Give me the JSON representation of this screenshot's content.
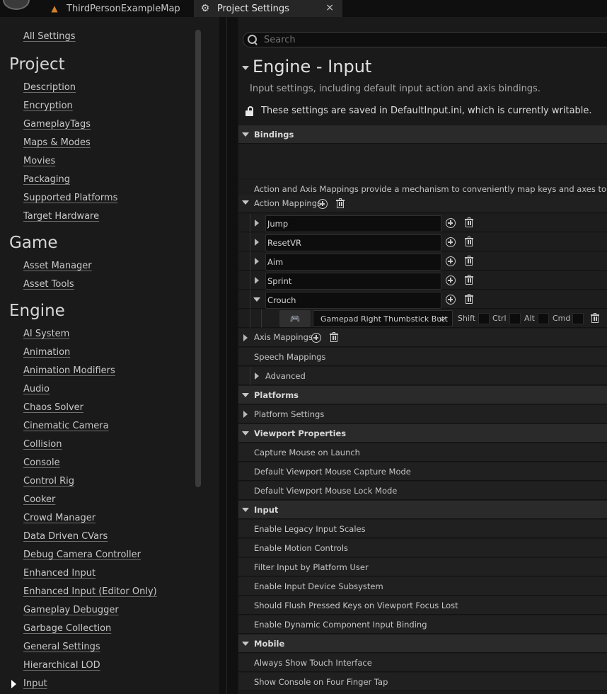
{
  "tabs": {
    "map": "ThirdPersonExampleMap",
    "settings": "Project Settings",
    "close": "×"
  },
  "sidebar": {
    "all_settings": "All Settings",
    "project_heading": "Project",
    "project_items": [
      "Description",
      "Encryption",
      "GameplayTags",
      "Maps & Modes",
      "Movies",
      "Packaging",
      "Supported Platforms",
      "Target Hardware"
    ],
    "game_heading": "Game",
    "game_items": [
      "Asset Manager",
      "Asset Tools"
    ],
    "engine_heading": "Engine",
    "engine_items": [
      "AI System",
      "Animation",
      "Animation Modifiers",
      "Audio",
      "Chaos Solver",
      "Cinematic Camera",
      "Collision",
      "Console",
      "Control Rig",
      "Cooker",
      "Crowd Manager",
      "Data Driven CVars",
      "Debug Camera Controller",
      "Enhanced Input",
      "Enhanced Input (Editor Only)",
      "Gameplay Debugger",
      "Garbage Collection",
      "General Settings",
      "Hierarchical LOD",
      "Input"
    ]
  },
  "search": {
    "placeholder": "Search"
  },
  "page": {
    "title": "Engine - Input",
    "subtitle": "Input settings, including default input action and axis bindings.",
    "writable_note": "These settings are saved in DefaultInput.ini, which is currently writable."
  },
  "bindings": {
    "header": "Bindings",
    "description": "Action and Axis Mappings provide a mechanism to conveniently map keys and axes to input behavi",
    "action_mappings_label": "Action Mappings",
    "actions": [
      "Jump",
      "ResetVR",
      "Aim",
      "Sprint",
      "Crouch"
    ],
    "crouch_key": "Gamepad Right Thumbstick Butt",
    "modifiers": [
      "Shift",
      "Ctrl",
      "Alt",
      "Cmd"
    ],
    "axis_mappings_label": "Axis Mappings",
    "speech_mappings_label": "Speech Mappings",
    "advanced_label": "Advanced"
  },
  "platforms": {
    "header": "Platforms",
    "settings_label": "Platform Settings"
  },
  "viewport": {
    "header": "Viewport Properties",
    "items": [
      "Capture Mouse on Launch",
      "Default Viewport Mouse Capture Mode",
      "Default Viewport Mouse Lock Mode"
    ]
  },
  "input": {
    "header": "Input",
    "items": [
      "Enable Legacy Input Scales",
      "Enable Motion Controls",
      "Filter Input by Platform User",
      "Enable Input Device Subsystem",
      "Should Flush Pressed Keys on Viewport Focus Lost",
      "Enable Dynamic Component Input Binding"
    ]
  },
  "mobile": {
    "header": "Mobile",
    "items": [
      "Always Show Touch Interface",
      "Show Console on Four Finger Tap"
    ]
  },
  "icons": {
    "app": "unreal-logo-icon",
    "map": "level-map-icon",
    "settings": "project-settings-icon",
    "gamepad": "gamepad-icon"
  }
}
